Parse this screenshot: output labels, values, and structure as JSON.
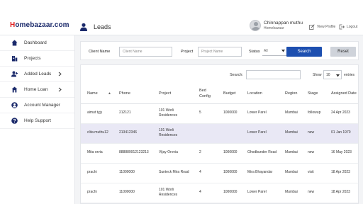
{
  "app": {
    "logo_prefix": "H",
    "logo_rest": "omebazaar.com"
  },
  "header": {
    "page_title": "Leads",
    "user_name": "Chinnappan muthu",
    "user_role": "Homebazaar",
    "view_profile": "View Profile",
    "logout": "Logout"
  },
  "sidebar": {
    "items": [
      {
        "label": "Dashboard",
        "icon": "home-icon"
      },
      {
        "label": "Projects",
        "icon": "building-icon"
      },
      {
        "label": "Added Leads",
        "icon": "user-plus-icon"
      },
      {
        "label": "Home Loan",
        "icon": "home-loan-icon"
      },
      {
        "label": "Account Manager",
        "icon": "user-circle-icon"
      },
      {
        "label": "Help Support",
        "icon": "help-icon"
      }
    ]
  },
  "filters": {
    "client_name_label": "Client Name",
    "client_name_placeholder": "Client Name",
    "client_name_value": "",
    "project_label": "Project",
    "project_placeholder": "Project Name",
    "project_value": "",
    "status_label": "Status",
    "status_value": "All",
    "search_button": "Search",
    "reset_button": "Reset"
  },
  "table_controls": {
    "search_label": "Search:",
    "show_label": "Show",
    "show_value": "10",
    "entries_label": "entries"
  },
  "table": {
    "columns": [
      "Name",
      "Phone",
      "Project",
      "Bed Config",
      "Budget",
      "Location",
      "Region",
      "Stage",
      "Assigned Date"
    ],
    "rows": [
      [
        "aimut tyjy",
        "212121",
        "101 Worli Residences",
        "5",
        "1000000",
        "Lower Parel",
        "Mumbai",
        "followup",
        "24 Apr 2023"
      ],
      [
        "clita muthu12",
        "213412346",
        "101 Worli Residences",
        "",
        "",
        "Lower Parel",
        "Mumbai",
        "new",
        "01 Jan 1970"
      ],
      [
        "Mita orvia",
        "888889912123213",
        "Vijay Orovia",
        "2",
        "1000000",
        "Ghodbunder Road",
        "Mumbai",
        "new",
        "16 May 2023"
      ],
      [
        "prachi",
        "11000000",
        "Sunteck Mira Road",
        "4",
        "1000000",
        "Mira Bhayandar",
        "Mumbai",
        "visit",
        "18 Apr 2023"
      ],
      [
        "prachi",
        "11000000",
        "101 Worli Residences",
        "4",
        "1000000",
        "Lower Parel",
        "Mumbai",
        "new",
        "18 Apr 2023"
      ]
    ]
  },
  "colors": {
    "primary": "#1d4fb0",
    "logo_navy": "#1b2a6b",
    "logo_red": "#e02020",
    "selected_row": "#e9e8f5"
  }
}
